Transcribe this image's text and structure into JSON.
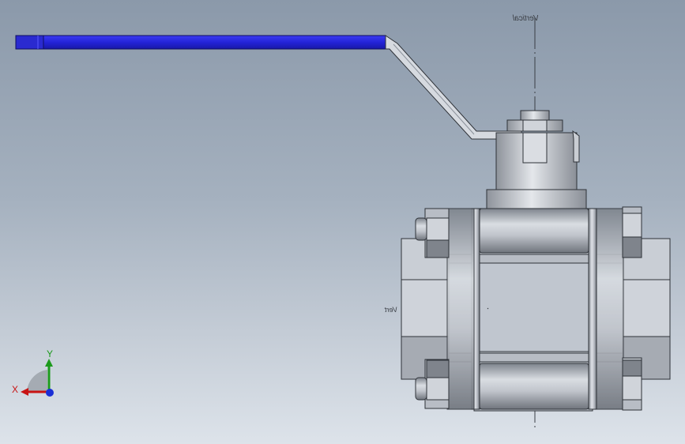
{
  "viewport": {
    "background_top": "#8b99aa",
    "background_bottom": "#dde3ea"
  },
  "plane_labels": {
    "top": "Vertical",
    "right": "Vert"
  },
  "triad": {
    "x_label": "X",
    "y_label": "Y",
    "x_color": "#c81414",
    "y_color": "#1c9a1c",
    "z_color": "#1a2fd6"
  },
  "model": {
    "handle_color": "#2b2be0",
    "body_color": "#b9bdc4"
  }
}
